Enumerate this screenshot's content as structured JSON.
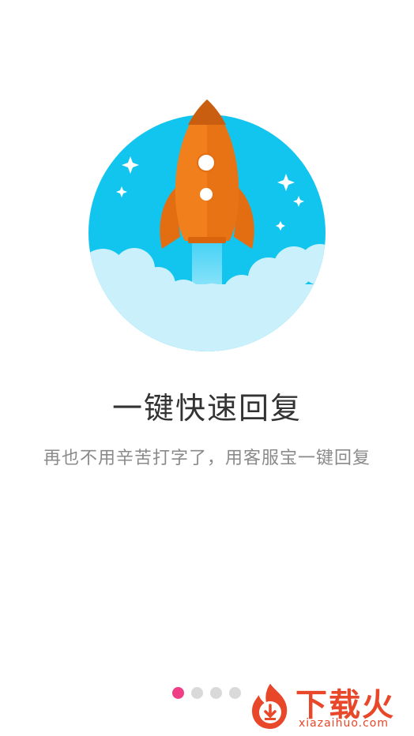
{
  "onboarding": {
    "title": "一键快速回复",
    "subtitle": "再也不用辛苦打字了，用客服宝一键回复",
    "illustration_icon": "rocket-icon",
    "current_page": 1,
    "total_pages": 4
  },
  "watermark": {
    "brand": "下载火",
    "url": "xiazaihuo.com"
  },
  "colors": {
    "sky": "#12c5ee",
    "cloud": "#c9f0fb",
    "rocket": "#f07f1c",
    "rocket_dark": "#c95e10",
    "active_dot": "#ef3e86",
    "inactive_dot": "#d9d9d9"
  }
}
